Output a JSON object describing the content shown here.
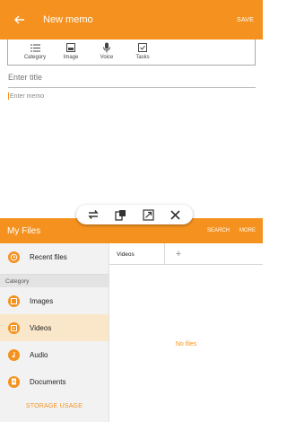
{
  "memo": {
    "title": "New memo",
    "save_label": "SAVE",
    "tools": [
      {
        "label": "Category",
        "icon": "list-icon"
      },
      {
        "label": "Image",
        "icon": "image-icon"
      },
      {
        "label": "Voice",
        "icon": "microphone-icon"
      },
      {
        "label": "Tasks",
        "icon": "checkbox-icon"
      }
    ],
    "title_placeholder": "Enter title",
    "memo_placeholder": "Enter memo"
  },
  "floating_controls": [
    "swap-icon",
    "pop-up-view-icon",
    "expand-icon",
    "close-icon"
  ],
  "files": {
    "title": "My Files",
    "search_label": "SEARCH",
    "more_label": "MORE",
    "recent_label": "Recent files",
    "category_header": "Category",
    "categories": [
      {
        "label": "Images",
        "icon": "image-icon"
      },
      {
        "label": "Videos",
        "icon": "video-icon"
      },
      {
        "label": "Audio",
        "icon": "music-note-icon"
      },
      {
        "label": "Documents",
        "icon": "document-icon"
      }
    ],
    "storage_label": "STORAGE USAGE",
    "tab_label": "Videos",
    "add_tab": "+",
    "empty_text": "No files"
  },
  "colors": {
    "accent": "#f5921f",
    "active_bg": "#fae7c9"
  }
}
